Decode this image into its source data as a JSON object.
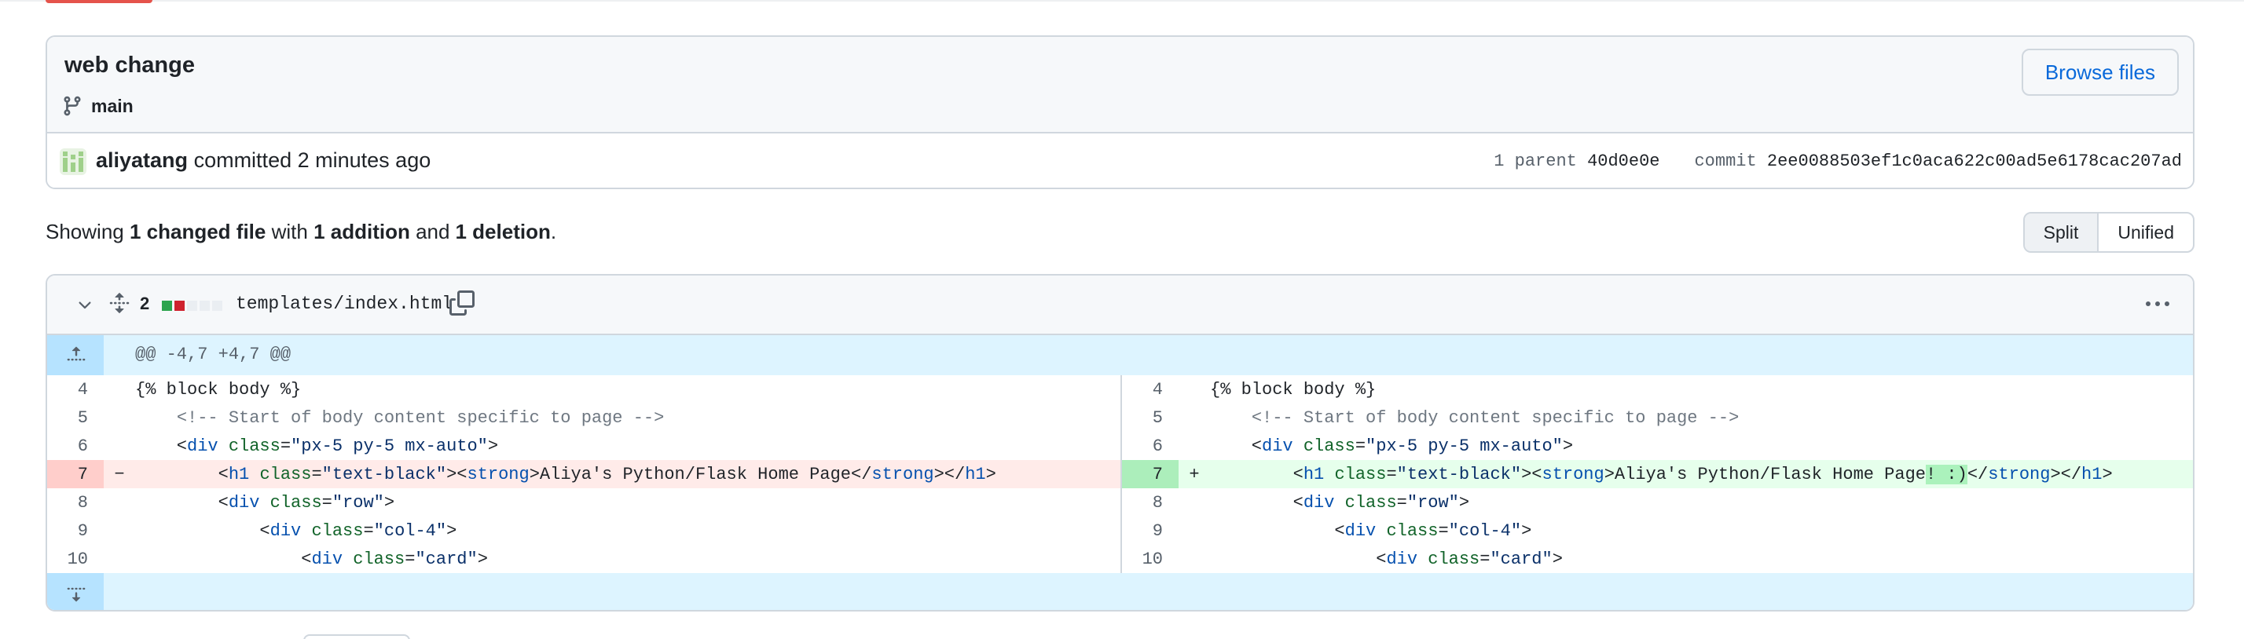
{
  "commit": {
    "title": "web change",
    "branch": "main",
    "browse_label": "Browse files",
    "author": "aliyatang",
    "action": "committed",
    "time": "2 minutes ago",
    "parent_label": "1 parent",
    "parent_sha": "40d0e0e",
    "commit_label": "commit",
    "commit_sha": "2ee0088503ef1c0aca622c00ad5e6178cac207ad"
  },
  "summary": {
    "prefix": "Showing",
    "files": "1 changed file",
    "with": "with",
    "additions": "1 addition",
    "and": "and",
    "deletions": "1 deletion",
    "end": "."
  },
  "view_toggle": {
    "split": "Split",
    "unified": "Unified",
    "active": "split"
  },
  "file": {
    "change_count": "2",
    "path": "templates/index.html",
    "diffstat": [
      "#2da44e",
      "#cf222e",
      "#eaeef2",
      "#eaeef2",
      "#eaeef2"
    ],
    "hunk_header": "@@ -4,7 +4,7 @@",
    "left": [
      {
        "n": "4",
        "mark": "",
        "type": "ctx",
        "code": "{% block body %}"
      },
      {
        "n": "5",
        "mark": "",
        "type": "ctx",
        "code": "    <!-- Start of body content specific to page -->"
      },
      {
        "n": "6",
        "mark": "",
        "type": "ctx",
        "code": "    <div class=\"px-5 py-5 mx-auto\">"
      },
      {
        "n": "7",
        "mark": "−",
        "type": "del",
        "code": "        <h1 class=\"text-black\"><strong>Aliya's Python/Flask Home Page</strong></h1>"
      },
      {
        "n": "8",
        "mark": "",
        "type": "ctx",
        "code": "        <div class=\"row\">"
      },
      {
        "n": "9",
        "mark": "",
        "type": "ctx",
        "code": "            <div class=\"col-4\">"
      },
      {
        "n": "10",
        "mark": "",
        "type": "ctx",
        "code": "                <div class=\"card\">"
      }
    ],
    "right": [
      {
        "n": "4",
        "mark": "",
        "type": "ctx",
        "code": "{% block body %}"
      },
      {
        "n": "5",
        "mark": "",
        "type": "ctx",
        "code": "    <!-- Start of body content specific to page -->"
      },
      {
        "n": "6",
        "mark": "",
        "type": "ctx",
        "code": "    <div class=\"px-5 py-5 mx-auto\">"
      },
      {
        "n": "7",
        "mark": "+",
        "type": "add",
        "code": "        <h1 class=\"text-black\"><strong>Aliya's Python/Flask Home Page! :)</strong></h1>"
      },
      {
        "n": "8",
        "mark": "",
        "type": "ctx",
        "code": "        <div class=\"row\">"
      },
      {
        "n": "9",
        "mark": "",
        "type": "ctx",
        "code": "            <div class=\"col-4\">"
      },
      {
        "n": "10",
        "mark": "",
        "type": "ctx",
        "code": "                <div class=\"card\">"
      }
    ]
  }
}
